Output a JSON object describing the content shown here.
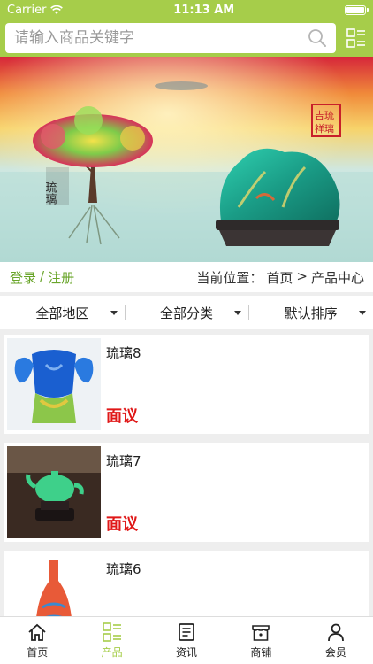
{
  "status": {
    "carrier": "Carrier",
    "time": "11:13 AM"
  },
  "search": {
    "placeholder": "请输入商品关键字"
  },
  "auth": {
    "login": "登录",
    "separator": "/",
    "register": "注册"
  },
  "breadcrumb": {
    "label": "当前位置：",
    "home": "首页",
    "separator": ">",
    "current": "产品中心"
  },
  "filters": [
    {
      "label": "全部地区"
    },
    {
      "label": "全部分类"
    },
    {
      "label": "默认排序"
    }
  ],
  "products": [
    {
      "name": "琉璃8",
      "price": "面议"
    },
    {
      "name": "琉璃7",
      "price": "面议"
    },
    {
      "name": "琉璃6",
      "price": ""
    }
  ],
  "banner": {
    "calligraphy_left": "琉璃",
    "seal_text": "吉祥琉璃"
  },
  "tabs": [
    {
      "label": "首页",
      "icon": "home-icon"
    },
    {
      "label": "产品",
      "icon": "product-icon",
      "active": true
    },
    {
      "label": "资讯",
      "icon": "news-icon"
    },
    {
      "label": "商铺",
      "icon": "shop-icon"
    },
    {
      "label": "会员",
      "icon": "user-icon"
    }
  ],
  "colors": {
    "accent": "#a6cd4a",
    "link": "#69a52a",
    "price": "#e01818"
  }
}
